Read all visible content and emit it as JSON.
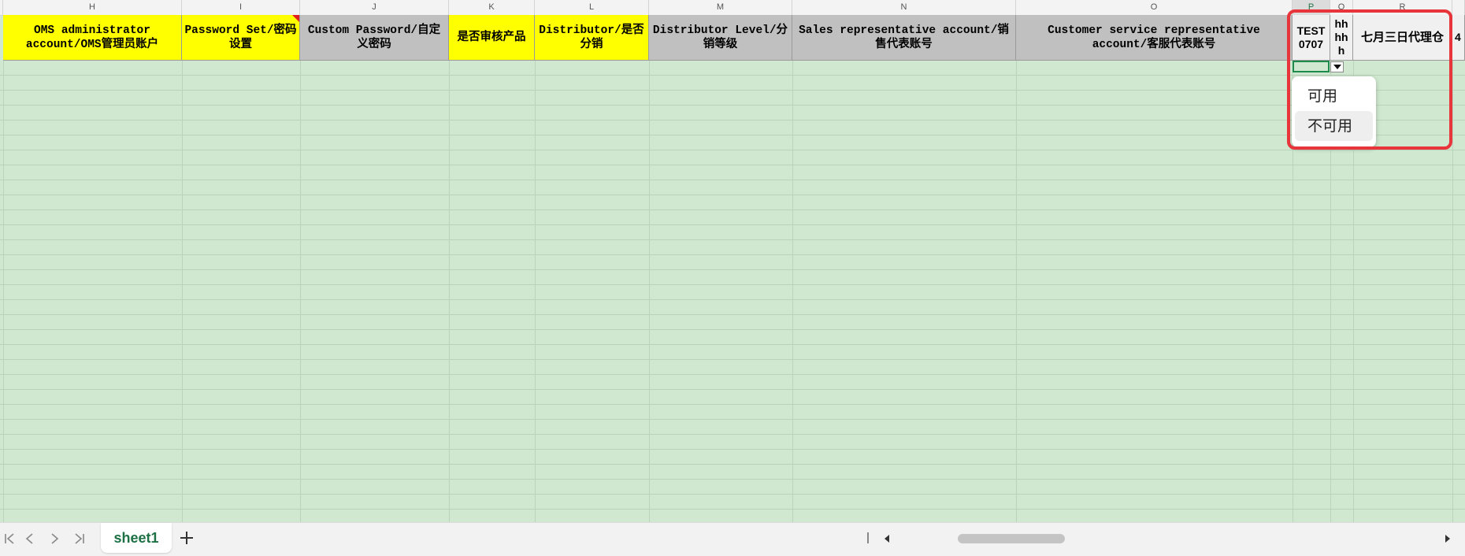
{
  "columns": [
    {
      "letter": "H",
      "header": "OMS administrator account/OMS管理员账户"
    },
    {
      "letter": "I",
      "header": "Password Set/密码设置"
    },
    {
      "letter": "J",
      "header": "Custom Password/自定义密码"
    },
    {
      "letter": "K",
      "header": "是否审核产品"
    },
    {
      "letter": "L",
      "header": "Distributor/是否分销"
    },
    {
      "letter": "M",
      "header": "Distributor Level/分销等级"
    },
    {
      "letter": "N",
      "header": "Sales representative account/销售代表账号"
    },
    {
      "letter": "O",
      "header": "Customer service representative account/客服代表账号"
    },
    {
      "letter": "P",
      "header": "TEST 0707"
    },
    {
      "letter": "Q",
      "header": "hh hh h"
    },
    {
      "letter": "R",
      "header": "七月三日代理仓"
    },
    {
      "letter": "",
      "header": "4"
    }
  ],
  "dropdown": {
    "options": [
      "可用",
      "不可用"
    ],
    "hovered": "不可用"
  },
  "tabs": {
    "sheets": [
      "sheet1"
    ],
    "active": "sheet1"
  },
  "colors": {
    "header_yellow": "#ffff00",
    "header_grey": "#c0c0c0",
    "grid_green": "#cfe8cf",
    "highlight_red": "#e8353b",
    "accent_green": "#1e7145"
  }
}
